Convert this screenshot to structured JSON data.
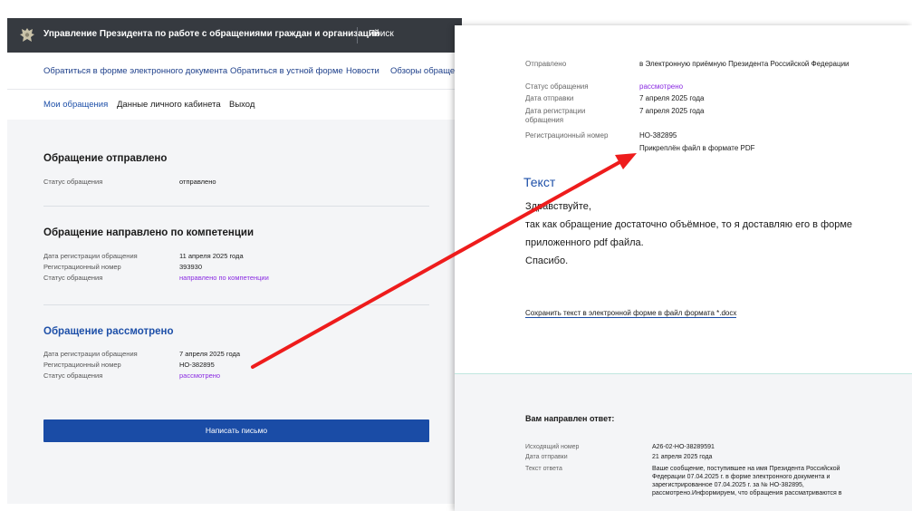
{
  "header": {
    "site_title": "Управление Президента по работе с обращениями граждан и организаций",
    "search": "Поиск"
  },
  "nav_main": [
    "Обратиться в форме электронного документа",
    "Обратиться в устной форме",
    "Новости",
    "Обзоры обраще"
  ],
  "nav_account": [
    "Мои обращения",
    "Данные личного кабинета",
    "Выход"
  ],
  "sections": [
    {
      "title": "Обращение отправлено",
      "rows": [
        {
          "label": "Статус обращения",
          "value": "отправлено"
        }
      ]
    },
    {
      "title": "Обращение направлено по компетенции",
      "rows": [
        {
          "label": "Дата регистрации обращения",
          "value": "11 апреля 2025 года"
        },
        {
          "label": "Регистрационный номер",
          "value": "393930"
        },
        {
          "label": "Статус обращения",
          "value": "направлено по компетенции"
        }
      ]
    },
    {
      "title": "Обращение рассмотрено",
      "rows": [
        {
          "label": "Дата регистрации обращения",
          "value": "7 апреля 2025 года"
        },
        {
          "label": "Регистрационный номер",
          "value": "НО-382895"
        },
        {
          "label": "Статус обращения",
          "value": "рассмотрено"
        }
      ]
    }
  ],
  "write_button": "Написать письмо",
  "detail": {
    "rows": [
      {
        "label": "Отправлено",
        "value": "в Электронную приёмную Президента Российской Федерации"
      },
      {
        "label": "Статус обращения",
        "value": "рассмотрено"
      },
      {
        "label": "Дата отправки",
        "value": "7 апреля 2025 года"
      },
      {
        "label": "Дата регистрации обращения",
        "value": "7 апреля 2025 года"
      },
      {
        "label": "Регистрационный номер",
        "value": "НО-382895"
      }
    ],
    "attachment_note": "Прикреплён файл в формате PDF",
    "text_heading": "Текст",
    "body_lines": [
      "Здравствуйте,",
      "так как обращение достаточно объёмное, то я доставляю его в форме",
      "приложенного pdf файла.",
      "Спасибо."
    ],
    "save_link": "Сохранить текст в электронной форме в файл формата *.docx"
  },
  "answer": {
    "title": "Вам направлен ответ:",
    "rows": [
      {
        "label": "Исходящий номер",
        "value": "А26-02-НО-38289591"
      },
      {
        "label": "Дата отправки",
        "value": "21 апреля 2025 года"
      },
      {
        "label": "Текст ответа",
        "value": "Ваше сообщение, поступившее на имя Президента Российской Федерации 07.04.2025 г. в форме электронного документа и зарегистрированное 07.04.2025 г. за № НО-382895, рассмотрено.Информируем, что обращения рассматриваются в"
      }
    ]
  },
  "colors": {
    "topbar": "#363a40",
    "link_blue": "#1d4fa8",
    "button_blue": "#1a4ca6",
    "status_purple": "#8a2be2",
    "arrow_red": "#ee1c1c"
  }
}
